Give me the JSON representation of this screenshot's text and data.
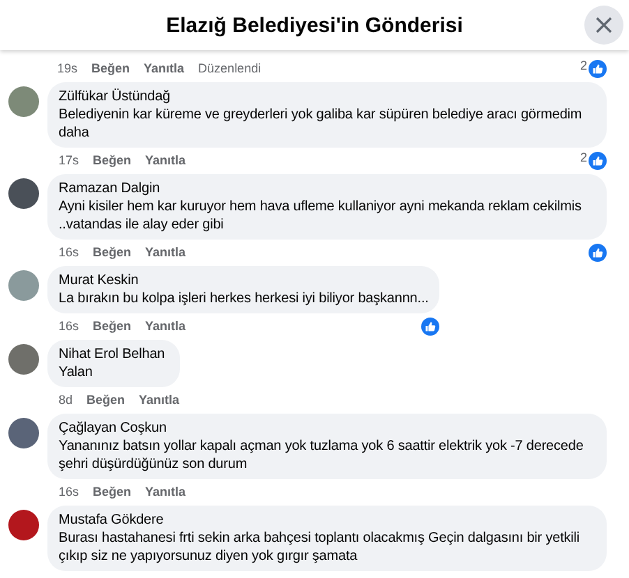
{
  "title": "Elazığ Belediyesi'in Gönderisi",
  "comments": [
    {
      "time": "19s",
      "actions": [
        "Beğen",
        "Yanıtla",
        "Düzenlendi"
      ],
      "liked": true,
      "like_count": "2"
    },
    {
      "color": "#7d8a78",
      "author": "Zülfükar Üstündağ",
      "text": "Belediyenin kar küreme ve greyderleri yok galiba kar süpüren belediye aracı görmedim daha",
      "time": "17s",
      "actions": [
        "Beğen",
        "Yanıtla"
      ],
      "liked": true,
      "like_count": "2"
    },
    {
      "color": "#4a5058",
      "author": "Ramazan Dalgin",
      "text": "Ayni kisiler hem kar kuruyor hem hava ufleme kullaniyor ayni mekanda reklam cekilmis ..vatandas ile alay eder gibi",
      "time": "16s",
      "actions": [
        "Beğen",
        "Yanıtla"
      ],
      "liked": true
    },
    {
      "color": "#8a9a9c",
      "author": "Murat Keskin",
      "text": "La bırakın bu kolpa işleri herkes herkesi iyi biliyor başkannn...",
      "time": "16s",
      "actions": [
        "Beğen",
        "Yanıtla"
      ],
      "liked": true
    },
    {
      "color": "#6f6f6a",
      "author": "Nihat Erol Belhan",
      "text": "Yalan",
      "time": "8d",
      "actions": [
        "Beğen",
        "Yanıtla"
      ],
      "liked": false
    },
    {
      "color": "#5a6478",
      "author": "Çağlayan Coşkun",
      "text": "Yananınız batsın yollar kapalı açman yok tuzlama yok 6 saattir elektrik yok -7 derecede şehri düşürdüğünüz son durum",
      "time": "16s",
      "actions": [
        "Beğen",
        "Yanıtla"
      ],
      "liked": false
    },
    {
      "color": "#b3171d",
      "author": "Mustafa Gökdere",
      "text": "Burası hastahanesi frti sekin arka bahçesi toplantı olacakmış Geçin dalgasını bir yetkili çıkıp siz ne yapıyorsunuz diyen yok gırgır şamata"
    }
  ]
}
